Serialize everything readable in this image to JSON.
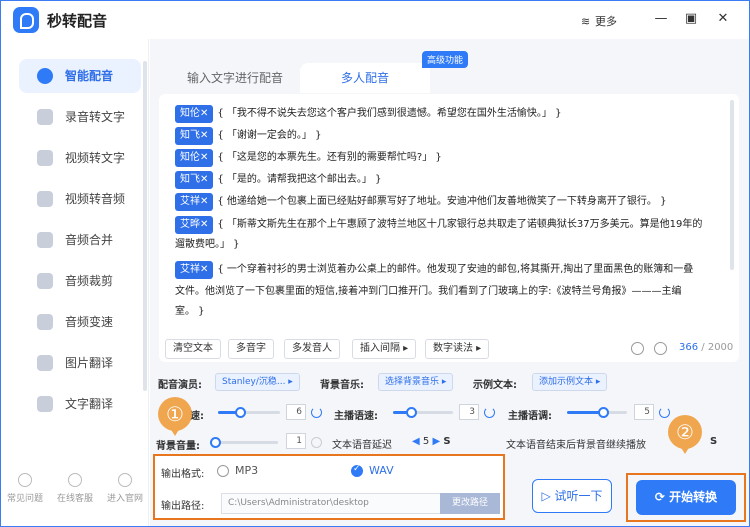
{
  "app": {
    "title": "秒转配音",
    "more": "更多"
  },
  "sidebar": {
    "items": [
      "智能配音",
      "录音转文字",
      "视频转文字",
      "视频转音频",
      "音频合并",
      "音频裁剪",
      "音频变速",
      "图片翻译",
      "文字翻译",
      "..."
    ],
    "bottom": [
      "常见问题",
      "在线客服",
      "进入官网"
    ]
  },
  "tabs": {
    "tab1": "输入文字进行配音",
    "tab2": "多人配音",
    "badge": "高级功能"
  },
  "lines": [
    {
      "speaker": "知伦✕",
      "text": "{ 「我不得不说失去您这个客户我们感到很遗憾。希望您在国外生活愉快。」 }"
    },
    {
      "speaker": "知飞✕",
      "text": "{ 「谢谢一定会的。」 }"
    },
    {
      "speaker": "知伦✕",
      "text": "{ 「这是您的本票先生。还有别的需要帮忙吗?」 }"
    },
    {
      "speaker": "知飞✕",
      "text": "{ 「是的。请帮我把这个邮出去。」 }"
    },
    {
      "speaker": "艾祥✕",
      "text": "{ 他递给她一个包裹上面已经贴好邮票写好了地址。安迪冲他们友善地微笑了一下转身离开了银行。 }"
    },
    {
      "speaker": "艾晔✕",
      "text": "{ 「斯蒂文斯先生在那个上午惠顾了波特兰地区十几家银行总共取走了诺顿典狱长37万多美元。算是他19年的"
    },
    {
      "speaker": "",
      "text": "遛散费吧。」 }"
    },
    {
      "speaker": "艾祥✕",
      "text": "{ 一个穿着衬衫的男士浏览着办公桌上的邮件。他发现了安迪的邮包,将其撕开,掏出了里面黑色的账簿和一叠"
    },
    {
      "speaker": "",
      "text": "文件。他浏览了一下包裹里面的短信,接着冲到门口推开门。我们看到了门玻璃上的字:《波特兰号角报》———主编"
    },
    {
      "speaker": "",
      "text": "室。 }"
    }
  ],
  "toolbar": {
    "clear": "清空文本",
    "poly": "多音字",
    "multi": "多发音人",
    "pause": "插入间隔 ▸",
    "digit": "数字读法 ▸",
    "count": "366",
    "max": "/ 2000"
  },
  "settings": {
    "voice_label": "配音演员:",
    "voice_value": "Stanley/沉稳... ▸",
    "bgm_label": "背景音乐:",
    "bgm_value": "选择背景音乐 ▸",
    "sample_label": "示例文本:",
    "sample_value": "添加示例文本 ▸",
    "speed_label": "速:",
    "speed_value": "6",
    "rate_label": "主播语速:",
    "rate_value": "3",
    "tone_label": "主播语调:",
    "tone_value": "5",
    "bgvol_label": "背景音量:",
    "bgvol_value": "1",
    "delay_label": "文本语音延迟",
    "delay_value": "5",
    "delay_unit": "S",
    "after_label": "文本语音结束后背景音继续播放",
    "after_unit": "S",
    "speed_level": 0.35,
    "rate_level": 0.3,
    "tone_level": 0.6,
    "bgvol_level": 0.05
  },
  "output": {
    "format_label": "输出格式:",
    "mp3": "MP3",
    "wav": "WAV",
    "path_label": "输出路径:",
    "path_value": "C:\\Users\\Administrator\\desktop",
    "path_btn": "更改路径"
  },
  "actions": {
    "preview": "试听一下",
    "start": "开始转换"
  },
  "callouts": {
    "one": "①",
    "two": "②"
  }
}
